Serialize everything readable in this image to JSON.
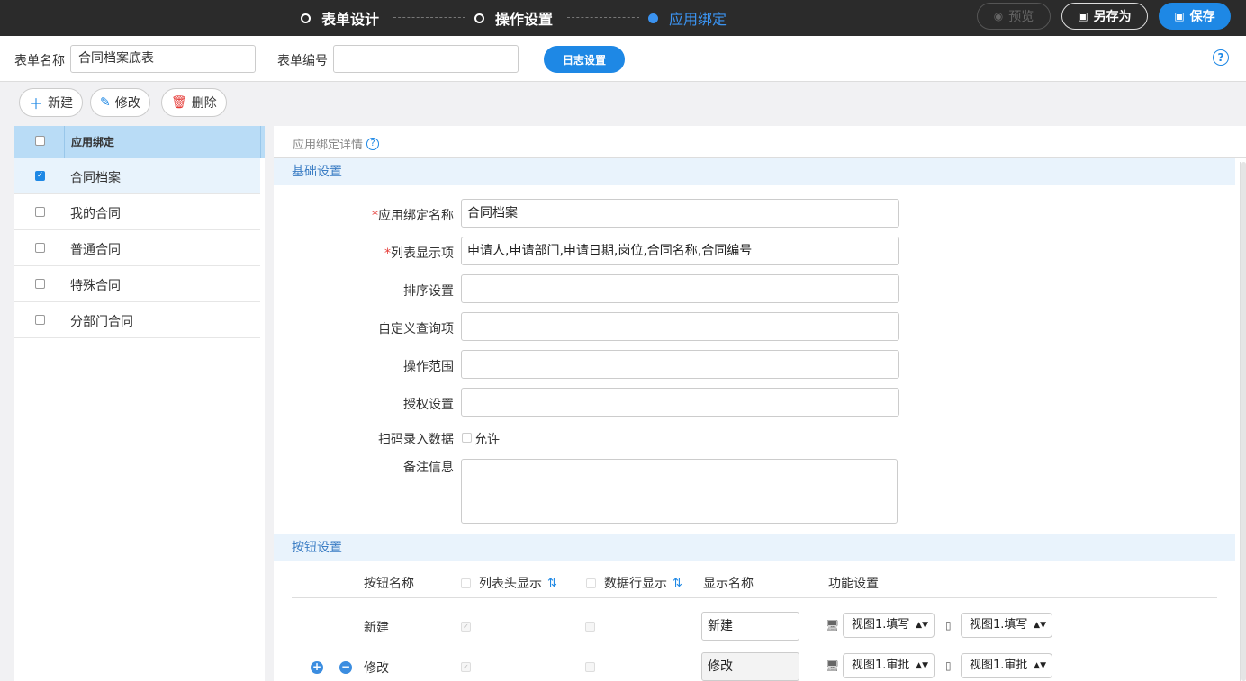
{
  "steps": [
    {
      "label": "表单设计"
    },
    {
      "label": "操作设置"
    },
    {
      "label": "应用绑定"
    }
  ],
  "toolbar_top": {
    "preview": "预览",
    "save_as": "另存为",
    "save": "保存"
  },
  "header": {
    "form_name_label": "表单名称",
    "form_name_value": "合同档案底表",
    "form_code_label": "表单编号",
    "form_code_value": "",
    "log_settings": "日志设置"
  },
  "actions": {
    "new": "新建",
    "edit": "修改",
    "delete": "删除"
  },
  "list": {
    "header": "应用绑定",
    "items": [
      {
        "label": "合同档案",
        "checked": true
      },
      {
        "label": "我的合同",
        "checked": false
      },
      {
        "label": "普通合同",
        "checked": false
      },
      {
        "label": "特殊合同",
        "checked": false
      },
      {
        "label": "分部门合同",
        "checked": false
      }
    ]
  },
  "detail": {
    "title": "应用绑定详情",
    "basic_section": "基础设置",
    "fields": {
      "binding_name_label": "应用绑定名称",
      "binding_name_value": "合同档案",
      "list_display_label": "列表显示项",
      "list_display_value": "申请人,申请部门,申请日期,岗位,合同名称,合同编号",
      "sort_label": "排序设置",
      "custom_query_label": "自定义查询项",
      "operation_scope_label": "操作范围",
      "auth_label": "授权设置",
      "scan_label": "扫码录入数据",
      "scan_option": "允许",
      "remark_label": "备注信息"
    },
    "button_section": "按钮设置",
    "button_table": {
      "col_name": "按钮名称",
      "col_list_header": "列表头显示",
      "col_data_row": "数据行显示",
      "col_display_name": "显示名称",
      "col_function": "功能设置",
      "rows": [
        {
          "name": "新建",
          "display": "新建",
          "pc": "视图1.填写",
          "mobile": "视图1.填写"
        },
        {
          "name": "修改",
          "display": "修改",
          "pc": "视图1.审批",
          "mobile": "视图1.审批"
        }
      ]
    }
  }
}
